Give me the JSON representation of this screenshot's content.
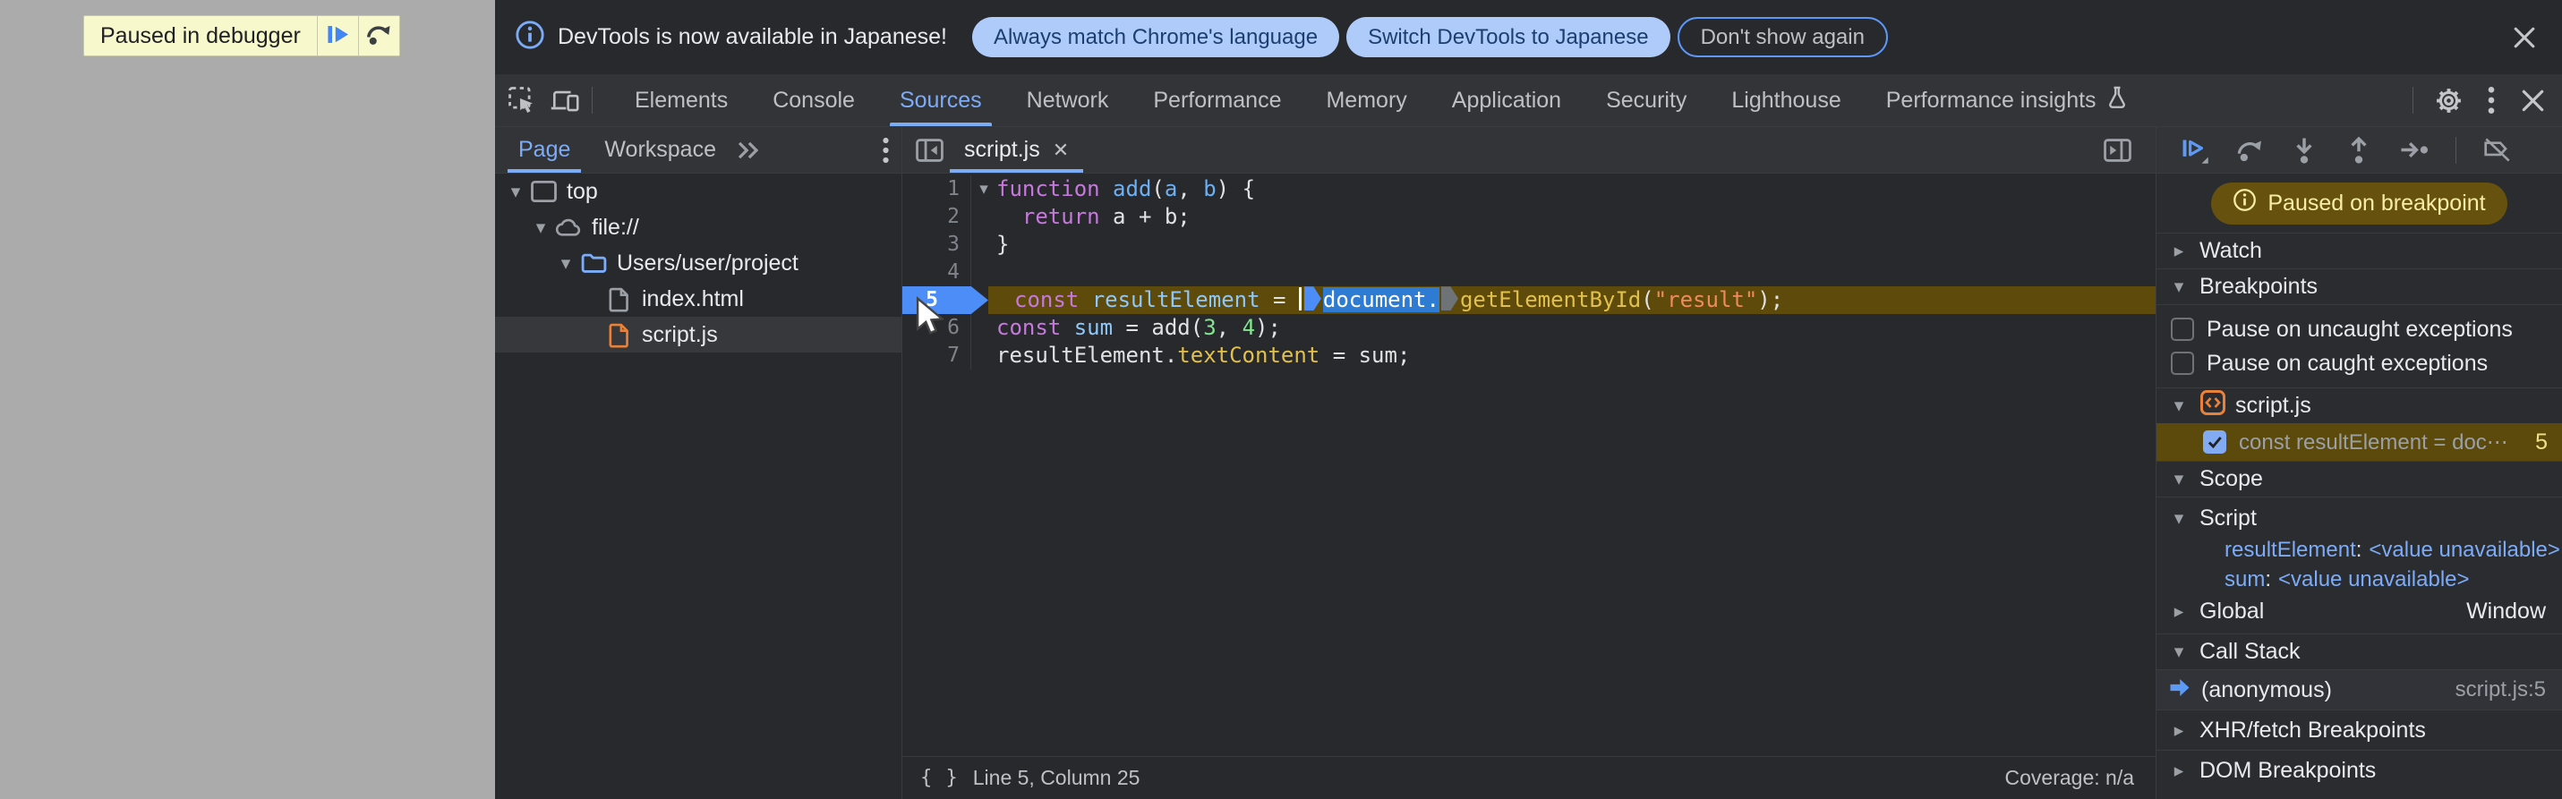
{
  "colors": {
    "page-gray": "#ABABAB",
    "panel": "#28292C",
    "toolbar": "#333438",
    "body2": "#2B2C2F",
    "border": "#3A3B3E",
    "accent": "#7CACF8",
    "blue-icon": "#5C9AF5",
    "text1": "#E8EAED",
    "text2": "#BDC1C6",
    "muted": "#9AA0A6",
    "sel-row": "#37383C",
    "paused-line": "#5E4A0A",
    "pill-bg": "#66520E",
    "pill-text": "#F6EDA8",
    "bp-row": "#5C4A0C",
    "bp-num": "#EDE287",
    "sel-blue": "#2E7BD4",
    "exec-badge": "#4C8DF8",
    "infobar-pill": "#AECBFA",
    "infobar-pill-text": "#1C3E70",
    "outline-blue": "#5E97F6",
    "olay-bg": "#F8F8CD",
    "olay-border": "#C9C9A8",
    "olay-blue": "#4285F4",
    "olay-dark": "#3C4043",
    "orange": "#E8823A",
    "tok-kw": "#C678DD",
    "tok-def": "#6CB0F5",
    "tok-var": "#8FC7F8",
    "tok-prop": "#E2C04E",
    "tok-str": "#F08A5C",
    "tok-num": "#83E58F",
    "tok-text": "#E2E2E2",
    "linenum": "#7E848A"
  },
  "page_overlay": {
    "paused_label": "Paused in debugger"
  },
  "infobar": {
    "message": "DevTools is now available in Japanese!",
    "buttons": [
      {
        "label": "Always match Chrome's language",
        "style": "filled"
      },
      {
        "label": "Switch DevTools to Japanese",
        "style": "filled"
      },
      {
        "label": "Don't show again",
        "style": "outlined"
      }
    ]
  },
  "main_tabs": {
    "items": [
      "Elements",
      "Console",
      "Sources",
      "Network",
      "Performance",
      "Memory",
      "Application",
      "Security",
      "Lighthouse",
      "Performance insights"
    ],
    "active": "Sources",
    "flask_tab": "Performance insights"
  },
  "navigator": {
    "tabs": {
      "page": "Page",
      "workspace": "Workspace"
    },
    "active_tab": "Page",
    "tree": [
      {
        "label": "top",
        "icon": "frame-icon",
        "depth": 0,
        "expanded": true
      },
      {
        "label": "file://",
        "icon": "cloud-icon",
        "depth": 1,
        "expanded": true
      },
      {
        "label": "Users/user/project",
        "icon": "folder-icon",
        "depth": 2,
        "expanded": true
      },
      {
        "label": "index.html",
        "icon": "file-icon",
        "depth": 3,
        "selected": false
      },
      {
        "label": "script.js",
        "icon": "js-file-icon",
        "depth": 3,
        "selected": true
      }
    ]
  },
  "editor": {
    "tab_label": "script.js",
    "lines": [
      {
        "num": 1,
        "fold": true,
        "tokens": [
          {
            "t": "function",
            "c": "kw"
          },
          {
            "t": " ",
            "c": "pl"
          },
          {
            "t": "add",
            "c": "def"
          },
          {
            "t": "(",
            "c": "pl"
          },
          {
            "t": "a",
            "c": "def"
          },
          {
            "t": ", ",
            "c": "pl"
          },
          {
            "t": "b",
            "c": "def"
          },
          {
            "t": ") {",
            "c": "pl"
          }
        ]
      },
      {
        "num": 2,
        "tokens": [
          {
            "t": "  ",
            "c": "pl"
          },
          {
            "t": "return",
            "c": "kw"
          },
          {
            "t": " a + b;",
            "c": "pl"
          }
        ]
      },
      {
        "num": 3,
        "tokens": [
          {
            "t": "}",
            "c": "pl"
          }
        ]
      },
      {
        "num": 4,
        "tokens": []
      },
      {
        "num": 5,
        "paused": true,
        "tokens": [
          {
            "t": "const",
            "c": "kw"
          },
          {
            "t": " ",
            "c": "pl"
          },
          {
            "t": "resultElement",
            "c": "var"
          },
          {
            "t": " = ",
            "c": "pl"
          },
          {
            "caret": true
          },
          {
            "badge": "blue"
          },
          {
            "t": "document.",
            "c": "sel"
          },
          {
            "badge": "gray"
          },
          {
            "t": "getElementById",
            "c": "prop"
          },
          {
            "t": "(",
            "c": "pl"
          },
          {
            "t": "\"result\"",
            "c": "str"
          },
          {
            "t": ");",
            "c": "pl"
          }
        ]
      },
      {
        "num": 6,
        "tokens": [
          {
            "t": "const",
            "c": "kw"
          },
          {
            "t": " ",
            "c": "pl"
          },
          {
            "t": "sum",
            "c": "var"
          },
          {
            "t": " = add(",
            "c": "pl"
          },
          {
            "t": "3",
            "c": "num"
          },
          {
            "t": ", ",
            "c": "pl"
          },
          {
            "t": "4",
            "c": "num"
          },
          {
            "t": ");",
            "c": "pl"
          }
        ]
      },
      {
        "num": 7,
        "tokens": [
          {
            "t": "resultElement.",
            "c": "pl"
          },
          {
            "t": "textContent",
            "c": "prop"
          },
          {
            "t": " = sum;",
            "c": "pl"
          }
        ]
      }
    ],
    "status": {
      "position": "Line 5, Column 25",
      "coverage": "Coverage: n/a"
    }
  },
  "debugger": {
    "paused_badge": "Paused on breakpoint",
    "watch_label": "Watch",
    "breakpoints": {
      "label": "Breakpoints",
      "pause_uncaught": "Pause on uncaught exceptions",
      "pause_caught": "Pause on caught exceptions",
      "file": "script.js",
      "entry": {
        "text": "const resultElement = doc⋯",
        "line": "5",
        "checked": true
      }
    },
    "scope": {
      "label": "Scope",
      "script_group": "Script",
      "vars": [
        {
          "name": "resultElement",
          "value": "<value unavailable>"
        },
        {
          "name": "sum",
          "value": "<value unavailable>"
        }
      ],
      "global_label": "Global",
      "global_value": "Window"
    },
    "call_stack": {
      "label": "Call Stack",
      "frame": {
        "name": "(anonymous)",
        "location": "script.js:5"
      }
    },
    "xhr_label": "XHR/fetch Breakpoints",
    "dom_label": "DOM Breakpoints"
  }
}
